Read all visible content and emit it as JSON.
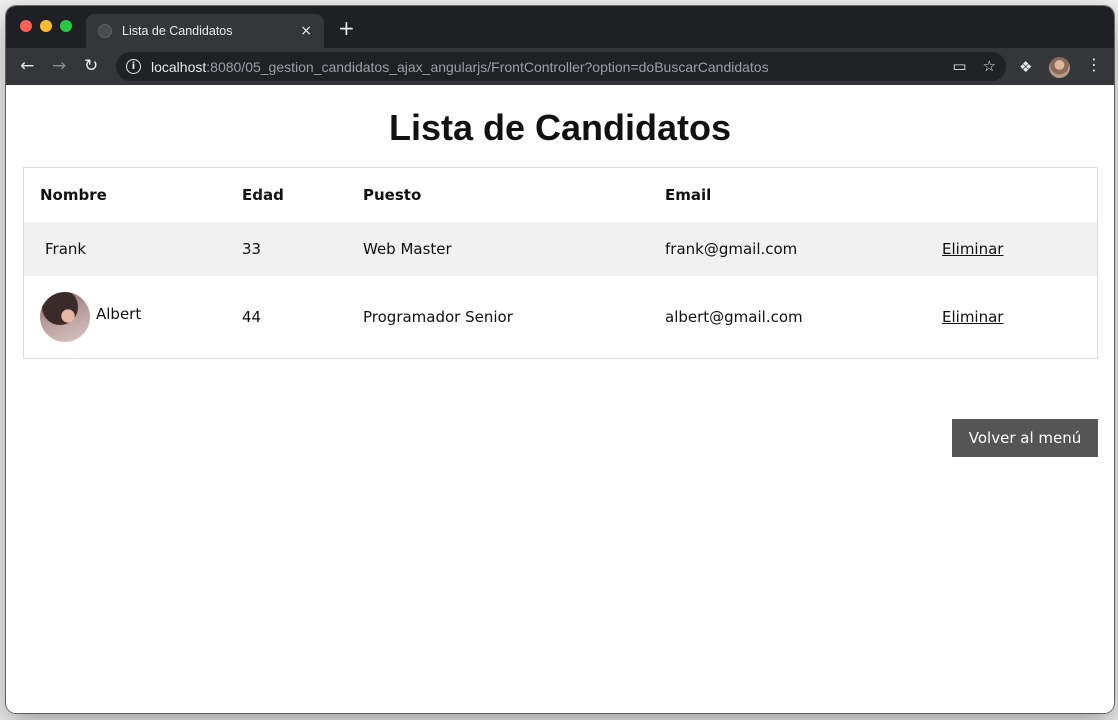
{
  "browser": {
    "tab_title": "Lista de Candidatos",
    "tab_close": "×",
    "new_tab": "+",
    "url_host": "localhost",
    "url_rest": ":8080/05_gestion_candidatos_ajax_angularjs/FrontController?option=doBuscarCandidatos",
    "icons": [
      "back-arrow-icon",
      "forward-arrow-icon",
      "reload-icon",
      "info-icon",
      "cast-icon",
      "star-icon",
      "puzzle-icon",
      "profile-avatar",
      "kebab-menu-icon"
    ]
  },
  "page": {
    "title": "Lista de Candidatos",
    "table": {
      "headers": [
        "Nombre",
        "Edad",
        "Puesto",
        "Email",
        ""
      ],
      "rows": [
        {
          "name": "Frank",
          "age": "33",
          "position": "Web Master",
          "email": "frank@gmail.com",
          "action": "Eliminar",
          "has_avatar": false
        },
        {
          "name": "Albert",
          "age": "44",
          "position": "Programador Senior",
          "email": "albert@gmail.com",
          "action": "Eliminar",
          "has_avatar": true
        }
      ]
    },
    "back_button": "Volver al menú"
  },
  "colors": {
    "tabstrip": "#1f2023",
    "toolbar": "#35363a",
    "row_highlight": "#f1f1f1",
    "button_bg": "#555555"
  }
}
